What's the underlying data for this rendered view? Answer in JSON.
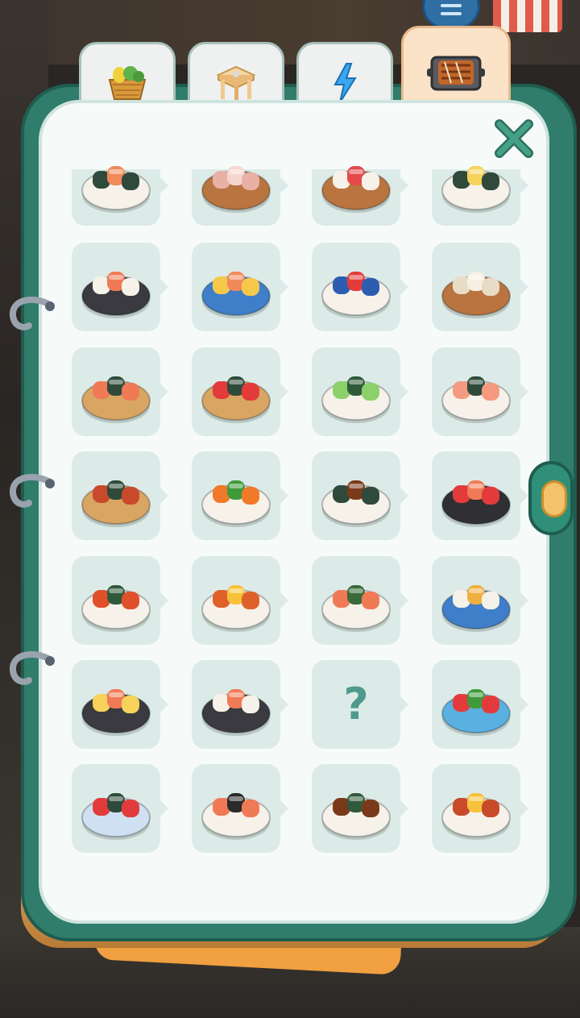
{
  "tabs": [
    {
      "name": "ingredients",
      "icon": "vegetable-basket-icon",
      "active": false
    },
    {
      "name": "furniture",
      "icon": "table-icon",
      "active": false
    },
    {
      "name": "energy",
      "icon": "lightning-icon",
      "active": false
    },
    {
      "name": "recipes",
      "icon": "grilled-dish-icon",
      "active": true
    }
  ],
  "colors": {
    "book_frame": "#2f7d6a",
    "page": "#f6fbfa",
    "tile": "#dcebe8",
    "close": "#3a8a76"
  },
  "recipes": [
    {
      "icon": "salmon-nigiri-icon"
    },
    {
      "icon": "octopus-sushi-icon"
    },
    {
      "icon": "tuna-nigiri-icon"
    },
    {
      "icon": "tamago-sushi-icon"
    },
    {
      "icon": "salmon-nigiri-board-icon"
    },
    {
      "icon": "salmon-sashimi-icon"
    },
    {
      "icon": "tuna-sashimi-icon"
    },
    {
      "icon": "white-fish-nigiri-icon"
    },
    {
      "icon": "salmon-hand-roll-icon"
    },
    {
      "icon": "tuna-hand-roll-icon"
    },
    {
      "icon": "cucumber-maki-icon"
    },
    {
      "icon": "shrimp-hand-roll-icon"
    },
    {
      "icon": "temaki-pair-icon"
    },
    {
      "icon": "ikura-gunkan-icon"
    },
    {
      "icon": "eel-roll-icon"
    },
    {
      "icon": "sashimi-platter-icon"
    },
    {
      "icon": "spicy-maki-icon"
    },
    {
      "icon": "egg-roll-icon"
    },
    {
      "icon": "salmon-maki-icon"
    },
    {
      "icon": "tempura-shrimp-icon"
    },
    {
      "icon": "nigiri-board-icon"
    },
    {
      "icon": "salmon-platter-icon"
    },
    {
      "icon": "question-mark-icon",
      "label": "?"
    },
    {
      "icon": "cone-sushi-stand-icon"
    },
    {
      "icon": "futomaki-icon"
    },
    {
      "icon": "maki-roll-plate-icon"
    },
    {
      "icon": "eel-maki-icon"
    },
    {
      "icon": "tamago-roll-icon"
    }
  ]
}
